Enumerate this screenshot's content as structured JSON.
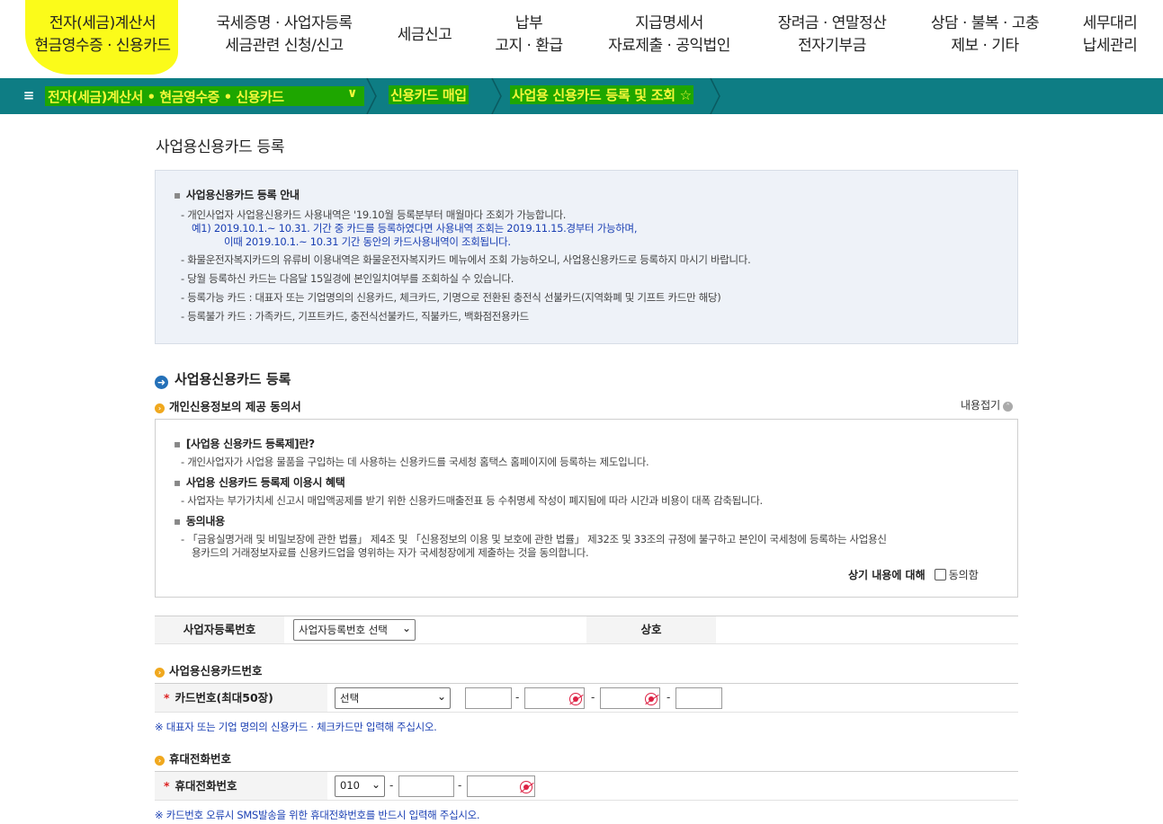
{
  "topnav": {
    "items": [
      {
        "line1": "전자(세금)계산서",
        "line2": "현금영수증 · 신용카드"
      },
      {
        "line1": "국세증명 · 사업자등록",
        "line2": "세금관련 신청/신고"
      },
      {
        "line1": "세금신고",
        "line2": ""
      },
      {
        "line1": "납부",
        "line2": "고지 · 환급"
      },
      {
        "line1": "지급명세서",
        "line2": "자료제출 · 공익법인"
      },
      {
        "line1": "장려금 · 연말정산",
        "line2": "전자기부금"
      },
      {
        "line1": "상담 · 불복 · 고충",
        "line2": "제보 · 기타"
      },
      {
        "line1": "세무대리",
        "line2": "납세관리"
      }
    ]
  },
  "breadcrumb": {
    "menu_icon": "≡",
    "level1": "전자(세금)계산서 • 현금영수증 • 신용카드",
    "level1_chevron": "∨",
    "level2": "신용카드 매입",
    "level3": "사업용 신용카드 등록 및 조회 ☆"
  },
  "page_title": "사업용신용카드 등록",
  "info": {
    "heading": "사업용신용카드 등록 안내",
    "lines": [
      "- 개인사업자 사업용신용카드 사용내역은 '19.10월 등록분부터 매월마다 조회가 가능합니다.",
      "예1) 2019.10.1.~ 10.31. 기간 중 카드를 등록하였다면 사용내역 조회는 2019.11.15.경부터 가능하며,",
      "이때 2019.10.1.~ 10.31 기간 동안의 카드사용내역이 조회됩니다.",
      "- 화물운전자복지카드의 유류비 이용내역은 화물운전자복지카드 메뉴에서 조회 가능하오니, 사업용신용카드로 등록하지 마시기 바랍니다.",
      "- 당월 등록하신 카드는 다음달 15일경에 본인일치여부를 조회하실 수 있습니다.",
      "- 등록가능 카드 : 대표자 또는 기업명의의 신용카드, 체크카드, 기명으로 전환된 충전식 선불카드(지역화폐 및 기프트 카드만 해당)",
      "- 등록불가 카드 : 가족카드, 기프트카드, 충전식선불카드, 직불카드, 백화점전용카드"
    ]
  },
  "section_title": "사업용신용카드 등록",
  "consent": {
    "title": "개인신용정보의 제공 동의서",
    "collapse": "내용접기",
    "q1": "[사업용 신용카드 등록제]란?",
    "a1": "- 개인사업자가 사업용 물품을 구입하는 데 사용하는 신용카드를 국세청 홈택스 홈페이지에 등록하는 제도입니다.",
    "q2": "사업용 신용카드 등록제 이용시 혜택",
    "a2": "- 사업자는 부가가치세 신고시 매입액공제를 받기 위한 신용카드매출전표 등 수취명세 작성이 폐지됨에 따라 시간과 비용이 대폭 감축됩니다.",
    "q3": "동의내용",
    "a3_line1": "- 「금융실명거래 및 비밀보장에 관한 법률」 제4조 및 「신용정보의 이용 및 보호에 관한 법률」 제32조 및 33조의 규정에 불구하고 본인이 국세청에 등록하는 사업용신",
    "a3_line2": "용카드의    거래정보자료를 신용카드업을 영위하는 자가 국세청장에게 제출하는 것을 동의합니다.",
    "agree_label": "상기 내용에 대해",
    "agree_option": "동의함"
  },
  "biz_row": {
    "label": "사업자등록번호",
    "select_value": "사업자등록번호 선택",
    "name_label": "상호"
  },
  "card_section": {
    "title": "사업용신용카드번호",
    "label": "카드번호(최대50장)",
    "select_value": "선택",
    "note": "※ 대표자 또는 기업 명의의 신용카드 · 체크카드만 입력해 주십시오."
  },
  "phone_section": {
    "title": "휴대전화번호",
    "label": "휴대전화번호",
    "prefix_value": "010",
    "note": "※ 카드번호 오류시 SMS발송을 위한 휴대전화번호를 반드시 입력해 주십시오."
  },
  "colors": {
    "teal_bar": "#0e7d84",
    "highlight_green": "#1ea600",
    "highlight_yellow": "#f3f73a",
    "nav_highlight": "#fbfb1a",
    "note_blue": "#1a3fb3"
  }
}
